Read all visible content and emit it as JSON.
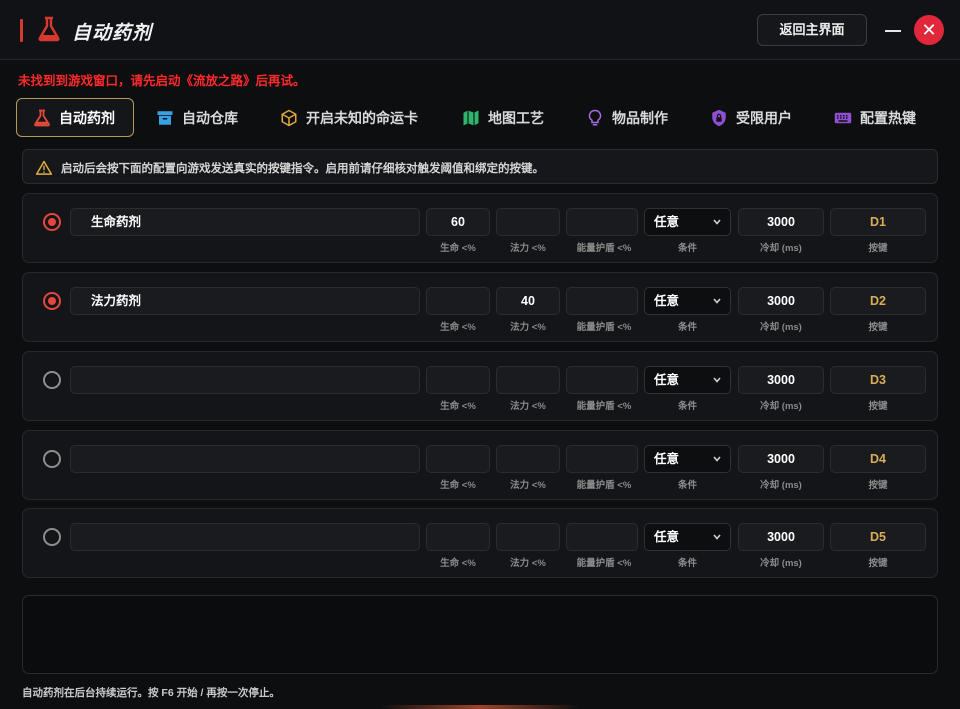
{
  "window": {
    "title": "自动药剂",
    "back_button": "返回主界面",
    "close_glyph": "✕"
  },
  "error_message": "未找到到游戏窗口，请先启动《流放之路》后再试。",
  "tabs": [
    {
      "label": "自动药剂",
      "icon": "flask-icon",
      "active": true
    },
    {
      "label": "自动仓库",
      "icon": "archive-box-icon",
      "active": false
    },
    {
      "label": "开启未知的命运卡",
      "icon": "cube-icon",
      "active": false
    },
    {
      "label": "地图工艺",
      "icon": "map-icon",
      "active": false
    },
    {
      "label": "物品制作",
      "icon": "lightbulb-icon",
      "active": false
    },
    {
      "label": "受限用户",
      "icon": "lock-shield-icon",
      "active": false
    },
    {
      "label": "配置热键",
      "icon": "keyboard-icon",
      "active": false
    }
  ],
  "notice": "启动后会按下面的配置向游戏发送真实的按键指令。启用前请仔细核对触发阈值和绑定的按键。",
  "labels": {
    "life": "生命 <%",
    "mana": "法力 <%",
    "shield": "能量护盾 <%",
    "condition": "条件",
    "cooldown": "冷却 (ms)",
    "key": "按键"
  },
  "rows": [
    {
      "enabled": true,
      "name": "生命药剂",
      "life": "60",
      "mana": "",
      "shield": "",
      "condition": "任意",
      "cooldown": "3000",
      "key": "D1"
    },
    {
      "enabled": true,
      "name": "法力药剂",
      "life": "",
      "mana": "40",
      "shield": "",
      "condition": "任意",
      "cooldown": "3000",
      "key": "D2"
    },
    {
      "enabled": false,
      "name": "",
      "life": "",
      "mana": "",
      "shield": "",
      "condition": "任意",
      "cooldown": "3000",
      "key": "D3"
    },
    {
      "enabled": false,
      "name": "",
      "life": "",
      "mana": "",
      "shield": "",
      "condition": "任意",
      "cooldown": "3000",
      "key": "D4"
    },
    {
      "enabled": false,
      "name": "",
      "life": "",
      "mana": "",
      "shield": "",
      "condition": "任意",
      "cooldown": "3000",
      "key": "D5"
    }
  ],
  "status": "自动药剂在后台持续运行。按 F6 开始 / 再按一次停止。",
  "colors": {
    "accent_red": "#d8392f",
    "active_tab_border": "#b39a58",
    "key_gold": "#d9ad55",
    "error_red": "#ff2a2a"
  }
}
